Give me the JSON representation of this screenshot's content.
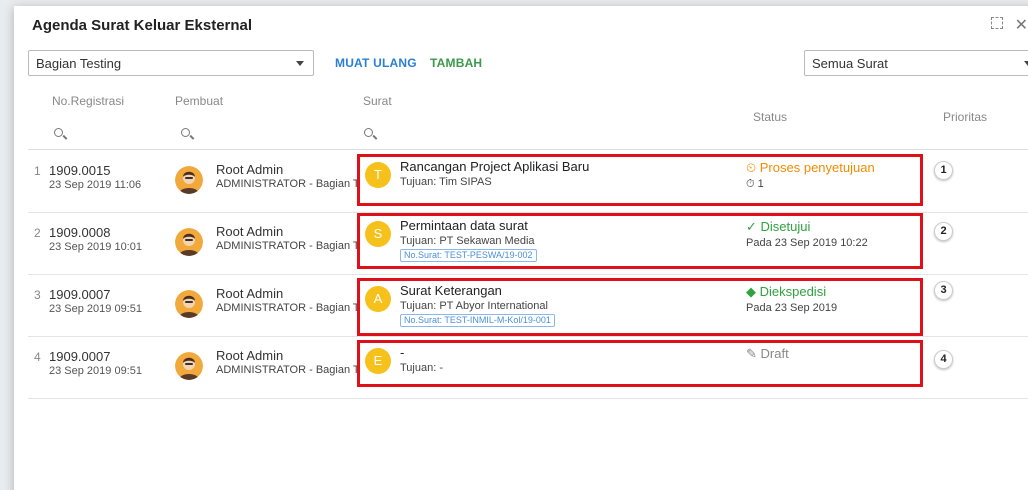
{
  "window": {
    "title": "Agenda Surat Keluar Eksternal"
  },
  "toolbar": {
    "bagian_value": "Bagian Testing",
    "muat_ulang": "MUAT ULANG",
    "tambah": "TAMBAH",
    "filter_value": "Semua Surat"
  },
  "table": {
    "headers": {
      "registrasi": "No.Registrasi",
      "pembuat": "Pembuat",
      "surat": "Surat",
      "status": "Status",
      "prioritas": "Prioritas"
    },
    "rows": [
      {
        "num": "1",
        "reg": "1909.0015",
        "date": "23 Sep 2019 11:06",
        "creator": "Root Admin",
        "role": "ADMINISTRATOR - Bagian Testing",
        "letter": "T",
        "subject": "Rancangan Project Aplikasi Baru",
        "tujuan": "Tujuan: Tim SIPAS",
        "no_surat": "",
        "status": "Proses penyetujuan",
        "status_icon": "clock-alert-icon",
        "status_sub": "1",
        "priority": "1"
      },
      {
        "num": "2",
        "reg": "1909.0008",
        "date": "23 Sep 2019 10:01",
        "creator": "Root Admin",
        "role": "ADMINISTRATOR - Bagian Testing",
        "letter": "S",
        "subject": "Permintaan data surat",
        "tujuan": "Tujuan: PT Sekawan Media",
        "no_surat": "No.Surat: TEST-PESWA/19-002",
        "status": "Disetujui",
        "status_icon": "check-icon",
        "status_sub": "Pada 23 Sep 2019 10:22",
        "priority": "2"
      },
      {
        "num": "3",
        "reg": "1909.0007",
        "date": "23 Sep 2019 09:51",
        "creator": "Root Admin",
        "role": "ADMINISTRATOR - Bagian Testing",
        "letter": "A",
        "subject": "Surat Keterangan",
        "tujuan": "Tujuan: PT Abyor International",
        "no_surat": "No.Surat: TEST-INMIL-M-Kol/19-001",
        "status": "Diekspedisi",
        "status_icon": "box-icon",
        "status_sub": "Pada 23 Sep 2019",
        "priority": "3"
      },
      {
        "num": "4",
        "reg": "1909.0007",
        "date": "23 Sep 2019 09:51",
        "creator": "Root Admin",
        "role": "ADMINISTRATOR - Bagian Testing",
        "letter": "E",
        "subject": "-",
        "tujuan": "Tujuan: -",
        "no_surat": "",
        "status": "Draft",
        "status_icon": "pencil-icon",
        "status_sub": "",
        "priority": "4"
      }
    ]
  },
  "colors": {
    "highlight": "#e0101a",
    "letter_avatar": "#f7c11b",
    "status_process": "#f08c00",
    "status_ok": "#2fa33f",
    "link_blue": "#2a7fd4"
  }
}
